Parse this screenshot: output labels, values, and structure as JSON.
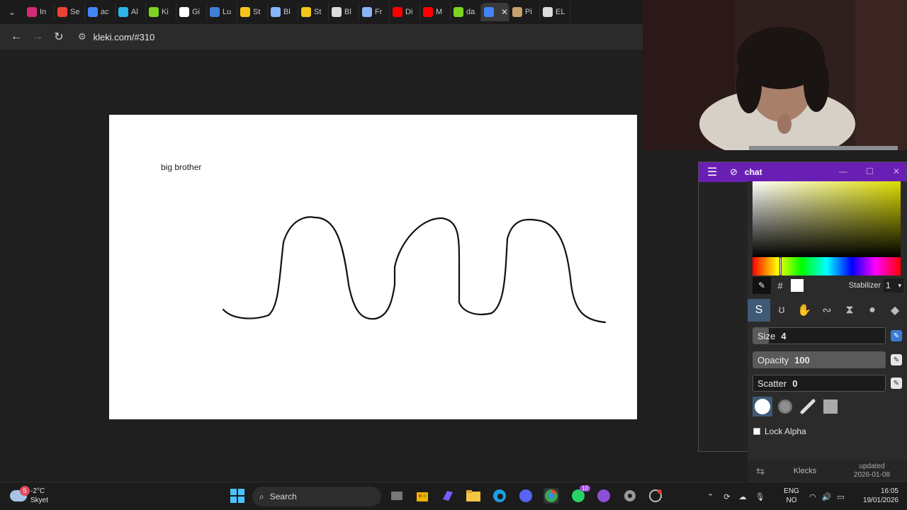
{
  "browser": {
    "tabs": [
      {
        "label": "In",
        "color": "#d62976"
      },
      {
        "label": "Se",
        "color": "#ea4335"
      },
      {
        "label": "ac",
        "color": "#4285f4"
      },
      {
        "label": "Al",
        "color": "#2bb5e8"
      },
      {
        "label": "Ki",
        "color": "#7ed321"
      },
      {
        "label": "Gi",
        "color": "#ffffff"
      },
      {
        "label": "Lu",
        "color": "#3f7fd6"
      },
      {
        "label": "St",
        "color": "#f5c518"
      },
      {
        "label": "Bl",
        "color": "#8ab4f8"
      },
      {
        "label": "St",
        "color": "#f5c518"
      },
      {
        "label": "Bl",
        "color": "#dddddd"
      },
      {
        "label": "Fr",
        "color": "#8ab4f8"
      },
      {
        "label": "Di",
        "color": "#ff0000"
      },
      {
        "label": "M",
        "color": "#ff0000"
      },
      {
        "label": "da",
        "color": "#7ed321"
      },
      {
        "label": "",
        "color": "#4285f4",
        "active": true
      },
      {
        "label": "Pi",
        "color": "#c8a06a"
      },
      {
        "label": "EL",
        "color": "#dddddd"
      }
    ],
    "url": "kleki.com/#310"
  },
  "canvas": {
    "text": "big brother"
  },
  "chat_window": {
    "title": "chat"
  },
  "tool_panel": {
    "stabilizer_label": "Stabilizer",
    "stabilizer_value": "1",
    "size_label": "Size",
    "size_value": "4",
    "size_fraction": 0.12,
    "opacity_label": "Opacity",
    "opacity_value": "100",
    "opacity_fraction": 1.0,
    "scatter_label": "Scatter",
    "scatter_value": "0",
    "scatter_fraction": 0.0,
    "lock_alpha_label": "Lock Alpha",
    "hex_symbol": "#"
  },
  "klecks_bar": {
    "brand": "Klecks",
    "updated_label": "updated",
    "updated_date": "2026-01-08"
  },
  "taskbar": {
    "weather_badge": "5",
    "temperature": "-2°C",
    "condition": "Skyet",
    "search_placeholder": "Search",
    "messenger_badge": "10",
    "lang_top": "ENG",
    "lang_bottom": "NO",
    "time": "16:05",
    "date": "19/01/2026"
  }
}
